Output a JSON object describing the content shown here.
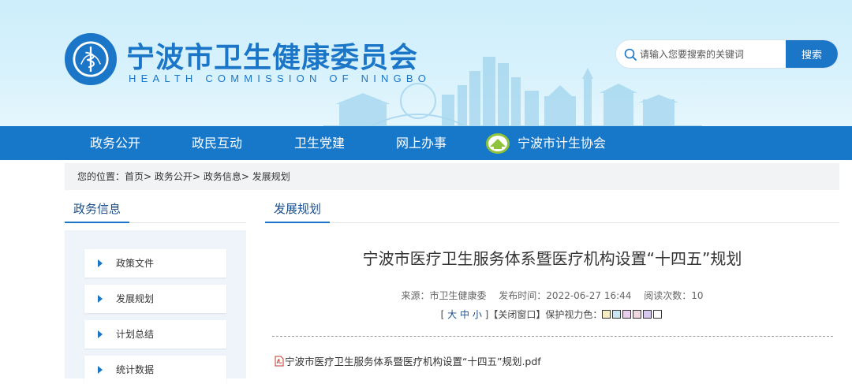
{
  "header": {
    "title": "宁波市卫生健康委员会",
    "subtitle": "HEALTH COMMISSION OF NINGBO",
    "emblem_icon": "health-emblem-icon",
    "search": {
      "placeholder": "请输入您要搜索的关键词",
      "button_label": "搜索"
    }
  },
  "nav": {
    "items": [
      "政务公开",
      "政民互动",
      "卫生党建",
      "网上办事"
    ],
    "partner_label": "宁波市计生协会",
    "partner_icon": "family-planning-logo-icon"
  },
  "breadcrumb": {
    "prefix": "您的位置：",
    "items": [
      "首页",
      "政务公开",
      "政务信息",
      "发展规划"
    ],
    "separator": ">"
  },
  "sidebar": {
    "title": "政务信息",
    "items": [
      "政策文件",
      "发展规划",
      "计划总结",
      "统计数据"
    ]
  },
  "main": {
    "section_title": "发展规划",
    "article": {
      "title": "宁波市医疗卫生服务体系暨医疗机构设置“十四五”规划",
      "source_label": "来源：市卫生健康委",
      "publish_label": "发布时间：2022-06-27 16:44",
      "views_label": "阅读次数：10",
      "font_sizes": [
        "大",
        "中",
        "小"
      ],
      "close_window": "【关闭窗口】",
      "eye_protect_label": "保护视力色：",
      "eye_colors": [
        "#f5eec4",
        "#c8e6f4",
        "#e8d0ec",
        "#f1d7e2",
        "#d7c8f0",
        "#ffffff"
      ],
      "attachment": "宁波市医疗卫生服务体系暨医疗机构设置“十四五”规划.pdf"
    }
  },
  "colors": {
    "brand": "#1b76c8",
    "nav_bg": "#1777c9",
    "header_bg": "#d3f0fc"
  }
}
